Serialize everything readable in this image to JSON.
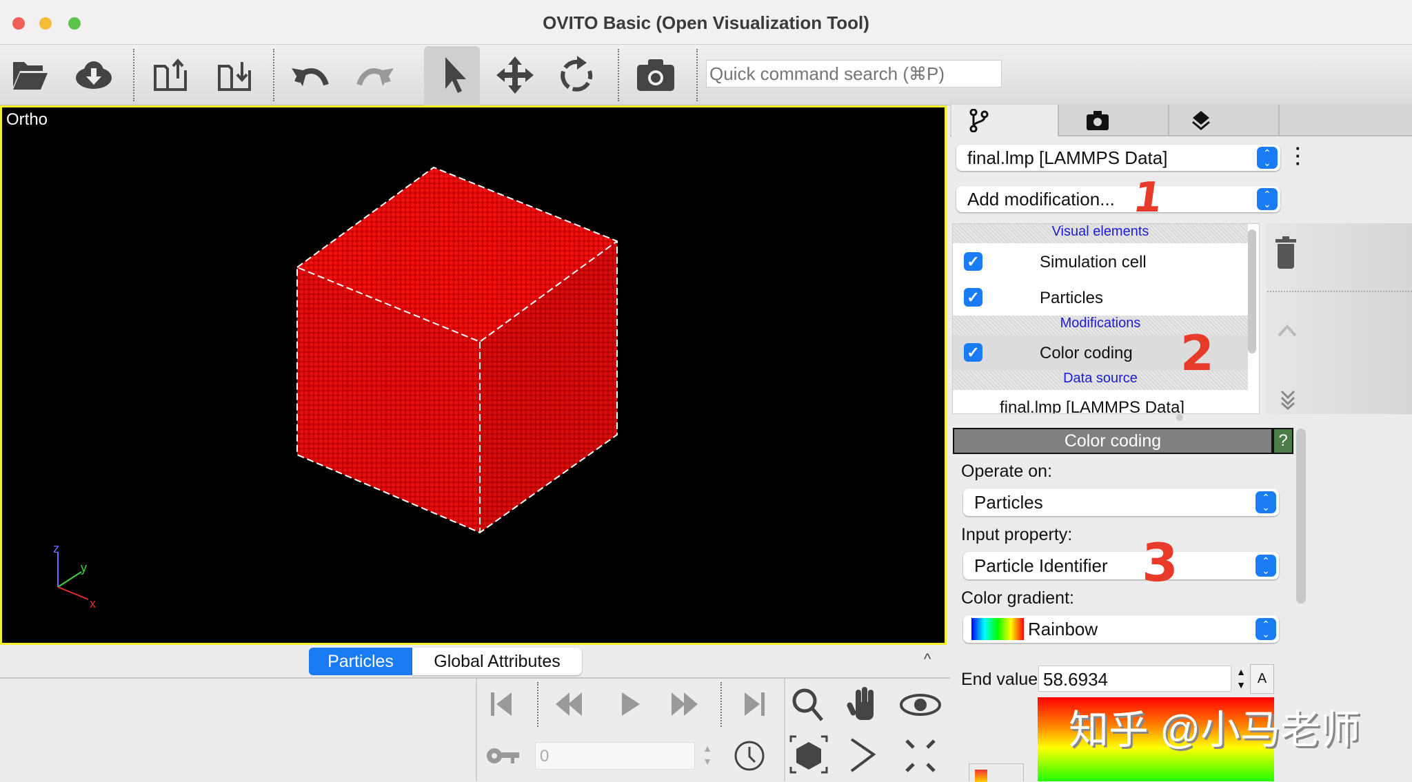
{
  "window": {
    "title": "OVITO Basic (Open Visualization Tool)"
  },
  "toolbar": {
    "icons": [
      "folder-open-icon",
      "cloud-download-icon",
      "export-icon",
      "import-icon",
      "undo-icon",
      "redo-icon",
      "select-arrow-icon",
      "move-icon",
      "rotate-icon",
      "camera-icon"
    ],
    "search_placeholder": "Quick command search (⌘P)"
  },
  "viewport": {
    "label": "Ortho",
    "axes": {
      "x": "x",
      "y": "y",
      "z": "z"
    },
    "highlight_color": "#f5f02a",
    "particle_color": "#e00000"
  },
  "bottom": {
    "tabs": [
      {
        "label": "Particles",
        "active": true
      },
      {
        "label": "Global Attributes",
        "active": false
      }
    ],
    "collapse": "^",
    "frame_value": "0"
  },
  "panel": {
    "source": "final.lmp [LAMMPS Data]",
    "add_modification": "Add modification...",
    "pipeline": {
      "visual_header": "Visual elements",
      "visual_items": [
        {
          "label": "Simulation cell",
          "checked": true
        },
        {
          "label": "Particles",
          "checked": true
        }
      ],
      "mod_header": "Modifications",
      "mod_items": [
        {
          "label": "Color coding",
          "checked": true
        }
      ],
      "source_header": "Data source",
      "source_item": "final.lmp [LAMMPS Data]"
    },
    "editor": {
      "title": "Color coding",
      "help": "?",
      "operate_label": "Operate on:",
      "operate_value": "Particles",
      "input_label": "Input property:",
      "input_value": "Particle Identifier",
      "gradient_label": "Color gradient:",
      "gradient_value": "Rainbow",
      "end_label": "End value:",
      "end_value": "58.6934",
      "auto_button": "A"
    }
  },
  "annotations": [
    "1",
    "2",
    "3"
  ],
  "watermark": "知乎 @小马老师"
}
